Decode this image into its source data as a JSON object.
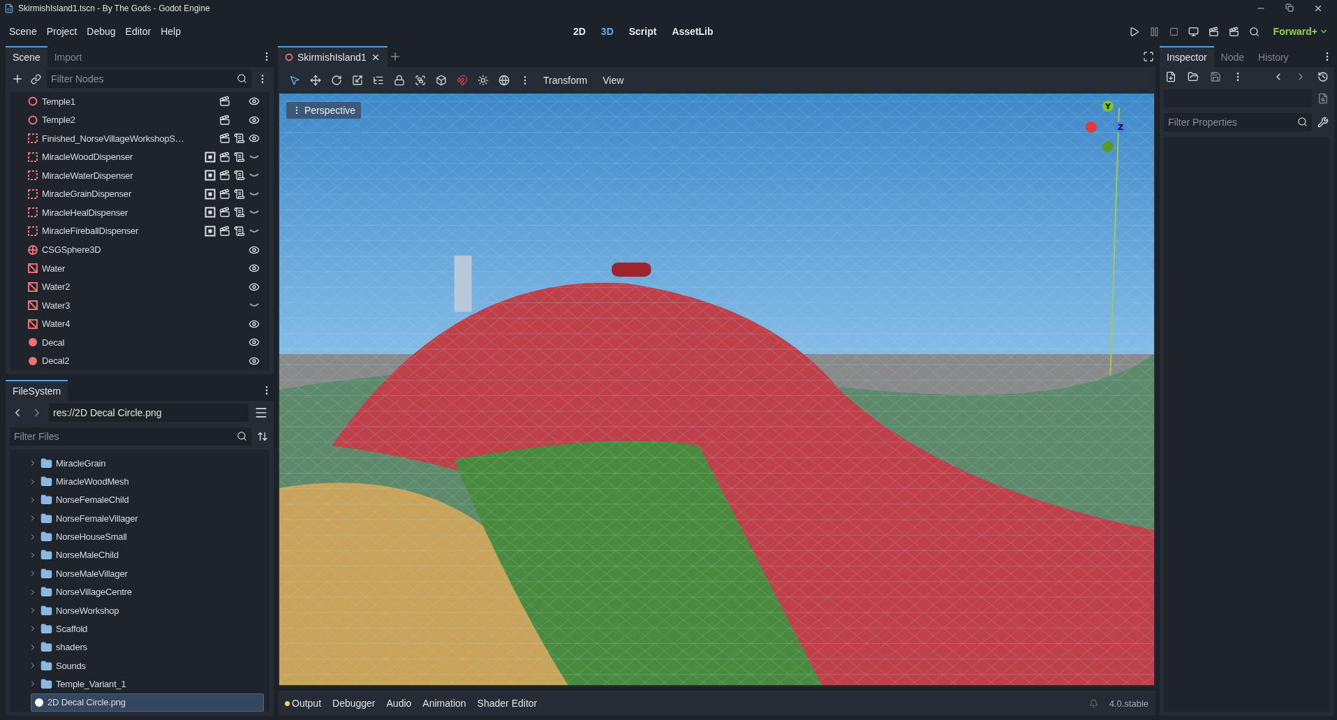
{
  "window": {
    "title": "SkirmishIsland1.tscn - By The Gods - Godot Engine"
  },
  "menu": [
    "Scene",
    "Project",
    "Debug",
    "Editor",
    "Help"
  ],
  "workspaces": [
    {
      "label": "2D",
      "selected": false
    },
    {
      "label": "3D",
      "selected": true
    },
    {
      "label": "Script",
      "selected": false
    },
    {
      "label": "AssetLib",
      "selected": false
    }
  ],
  "renderer": "Forward+",
  "scene_dock": {
    "tabs": [
      {
        "label": "Scene",
        "selected": true
      },
      {
        "label": "Import",
        "selected": false
      }
    ],
    "filter": {
      "placeholder": "Filter Nodes"
    },
    "nodes": [
      {
        "name": "Temple1",
        "kind": "ring",
        "group": false,
        "instance": true,
        "script": false,
        "visible": true
      },
      {
        "name": "Temple2",
        "kind": "ring",
        "group": false,
        "instance": true,
        "script": false,
        "visible": true
      },
      {
        "name": "Finished_NorseVillageWorkshopS…",
        "kind": "frame",
        "group": false,
        "instance": true,
        "script": true,
        "visible": true
      },
      {
        "name": "MiracleWoodDispenser",
        "kind": "frame",
        "group": true,
        "instance": true,
        "script": true,
        "visible": false
      },
      {
        "name": "MiracleWaterDispenser",
        "kind": "frame",
        "group": true,
        "instance": true,
        "script": true,
        "visible": false
      },
      {
        "name": "MiracleGrainDispenser",
        "kind": "frame",
        "group": true,
        "instance": true,
        "script": true,
        "visible": false
      },
      {
        "name": "MiracleHealDispenser",
        "kind": "frame",
        "group": true,
        "instance": true,
        "script": true,
        "visible": false
      },
      {
        "name": "MiracleFireballDispenser",
        "kind": "frame",
        "group": true,
        "instance": true,
        "script": true,
        "visible": false
      },
      {
        "name": "CSGSphere3D",
        "kind": "csg",
        "group": false,
        "instance": false,
        "script": false,
        "visible": true
      },
      {
        "name": "Water",
        "kind": "mesh",
        "group": false,
        "instance": false,
        "script": false,
        "visible": true
      },
      {
        "name": "Water2",
        "kind": "mesh",
        "group": false,
        "instance": false,
        "script": false,
        "visible": true
      },
      {
        "name": "Water3",
        "kind": "mesh",
        "group": false,
        "instance": false,
        "script": false,
        "visible": false
      },
      {
        "name": "Water4",
        "kind": "mesh",
        "group": false,
        "instance": false,
        "script": false,
        "visible": true
      },
      {
        "name": "Decal",
        "kind": "decal",
        "group": false,
        "instance": false,
        "script": false,
        "visible": true
      },
      {
        "name": "Decal2",
        "kind": "decal",
        "group": false,
        "instance": false,
        "script": false,
        "visible": true
      }
    ]
  },
  "filesystem": {
    "tab": "FileSystem",
    "path": "res://2D Decal Circle.png",
    "filter": {
      "placeholder": "Filter Files"
    },
    "items": [
      {
        "name": "MiracleGrain",
        "kind": "folder",
        "selected": false
      },
      {
        "name": "MiracleWoodMesh",
        "kind": "folder",
        "selected": false
      },
      {
        "name": "NorseFemaleChild",
        "kind": "folder",
        "selected": false
      },
      {
        "name": "NorseFemaleVillager",
        "kind": "folder",
        "selected": false
      },
      {
        "name": "NorseHouseSmall",
        "kind": "folder",
        "selected": false
      },
      {
        "name": "NorseMaleChild",
        "kind": "folder",
        "selected": false
      },
      {
        "name": "NorseMaleVillager",
        "kind": "folder",
        "selected": false
      },
      {
        "name": "NorseVillageCentre",
        "kind": "folder",
        "selected": false
      },
      {
        "name": "NorseWorkshop",
        "kind": "folder",
        "selected": false
      },
      {
        "name": "Scaffold",
        "kind": "folder",
        "selected": false
      },
      {
        "name": "shaders",
        "kind": "folder",
        "selected": false
      },
      {
        "name": "Sounds",
        "kind": "folder",
        "selected": false
      },
      {
        "name": "Temple_Variant_1",
        "kind": "folder",
        "selected": false
      },
      {
        "name": "2D Decal Circle.png",
        "kind": "file",
        "selected": true
      }
    ]
  },
  "editor": {
    "tabs": [
      {
        "label": "SkirmishIsland1",
        "selected": true
      }
    ],
    "toolbar_menus": [
      "Transform",
      "View"
    ],
    "viewport": {
      "mode": "Perspective",
      "gizmo": {
        "y": "Y",
        "z": "Z"
      }
    }
  },
  "inspector": {
    "tabs": [
      {
        "label": "Inspector",
        "selected": true
      },
      {
        "label": "Node",
        "selected": false
      },
      {
        "label": "History",
        "selected": false
      }
    ],
    "filter": {
      "placeholder": "Filter Properties"
    }
  },
  "bottom_panel": {
    "tabs": [
      {
        "label": "Output",
        "alert": true
      },
      {
        "label": "Debugger",
        "alert": false
      },
      {
        "label": "Audio",
        "alert": false
      },
      {
        "label": "Animation",
        "alert": false
      },
      {
        "label": "Shader Editor",
        "alert": false
      }
    ],
    "version": "4.0.stable"
  }
}
